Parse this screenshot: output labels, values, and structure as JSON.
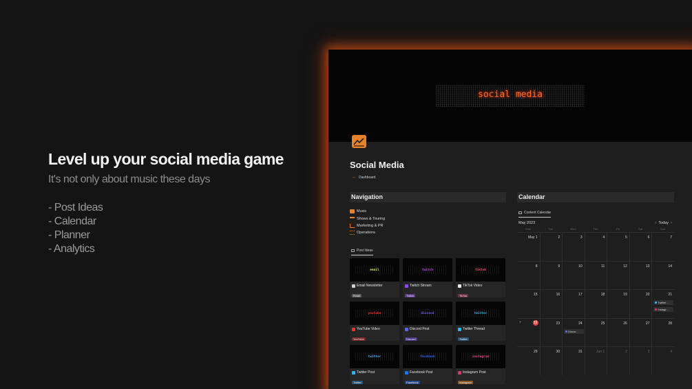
{
  "hero": {
    "title": "Level up your social media game",
    "subtitle": "It's not only about music these days",
    "list": [
      "- Post Ideas",
      "- Calendar",
      "- Planner",
      "- Analytics"
    ]
  },
  "cover": {
    "title": "social media"
  },
  "page": {
    "title": "Social Media",
    "breadcrumb": "Dashboard",
    "accent": "#e8822a"
  },
  "navigation": {
    "heading": "Navigation",
    "items": [
      {
        "label": "Music",
        "icon": "music-icon"
      },
      {
        "label": "Shows & Touring",
        "icon": "stage-icon"
      },
      {
        "label": "Marketing & PR",
        "icon": "chart-icon"
      },
      {
        "label": "Operations",
        "icon": "list-icon"
      }
    ]
  },
  "gallery": {
    "tab": "Post Ideas",
    "cards": [
      {
        "word": "email",
        "word_color": "#d9e84a",
        "title": "Email Newsletter",
        "tag": "Email",
        "tag_color": "#5a5a5a",
        "icon_color": "#cfcfcf"
      },
      {
        "word": "twitch",
        "word_color": "#c24af0",
        "title": "Twitch Stream",
        "tag": "Twitch",
        "tag_color": "#5b3b86",
        "icon_color": "#9146ff"
      },
      {
        "word": "tiktok",
        "word_color": "#ff4a6a",
        "title": "TikTok Video",
        "tag": "TikTok",
        "tag_color": "#6b2f3d",
        "icon_color": "#eaeaea"
      },
      {
        "word": "youtube",
        "word_color": "#ff2a2a",
        "title": "YouTube Video",
        "tag": "YouTube",
        "tag_color": "#7a2a2a",
        "icon_color": "#ff2a2a"
      },
      {
        "word": "discord",
        "word_color": "#7a5cff",
        "title": "Discord Post",
        "tag": "Discord",
        "tag_color": "#4a3a86",
        "icon_color": "#5865f2"
      },
      {
        "word": "twitter",
        "word_color": "#2ab4ff",
        "title": "Twitter Thread",
        "tag": "Twitter",
        "tag_color": "#2a5576",
        "icon_color": "#2ab4ff"
      },
      {
        "word": "twitter",
        "word_color": "#2ab4ff",
        "title": "Twitter Post",
        "tag": "Twitter",
        "tag_color": "#2a5576",
        "icon_color": "#2ab4ff"
      },
      {
        "word": "facebook",
        "word_color": "#2a6aff",
        "title": "Facebook Post",
        "tag": "Facebook",
        "tag_color": "#2a4a86",
        "icon_color": "#1877f2"
      },
      {
        "word": "instagram",
        "word_color": "#ff3a8a",
        "title": "Instagram Post",
        "tag": "Instagram",
        "tag_color": "#8a5a2a",
        "icon_color": "#e1306c"
      }
    ]
  },
  "calendar": {
    "heading": "Calendar",
    "tab": "Content Calendar",
    "month": "May 2023",
    "today_label": "Today",
    "dow": [
      "Mon",
      "Tue",
      "Wed",
      "Thu",
      "Fri",
      "Sat",
      "Sun"
    ],
    "weeks": [
      [
        "May 1",
        "2",
        "3",
        "4",
        "5",
        "6",
        "7"
      ],
      [
        "8",
        "9",
        "10",
        "11",
        "12",
        "13",
        "14"
      ],
      [
        "15",
        "16",
        "17",
        "18",
        "19",
        "20",
        "21"
      ],
      [
        "22",
        "23",
        "24",
        "25",
        "26",
        "27",
        "28"
      ],
      [
        "29",
        "30",
        "31",
        "Jun 1",
        "2",
        "3",
        "4"
      ]
    ],
    "today": "22",
    "events": [
      {
        "week": 2,
        "day": 6,
        "slot": 0,
        "label": "Twitter ...",
        "color": "#2ab4ff"
      },
      {
        "week": 2,
        "day": 6,
        "slot": 1,
        "label": "Instagr...",
        "color": "#e1306c"
      },
      {
        "week": 3,
        "day": 2,
        "slot": 0,
        "label": "Discor...",
        "color": "#5865f2"
      }
    ]
  }
}
